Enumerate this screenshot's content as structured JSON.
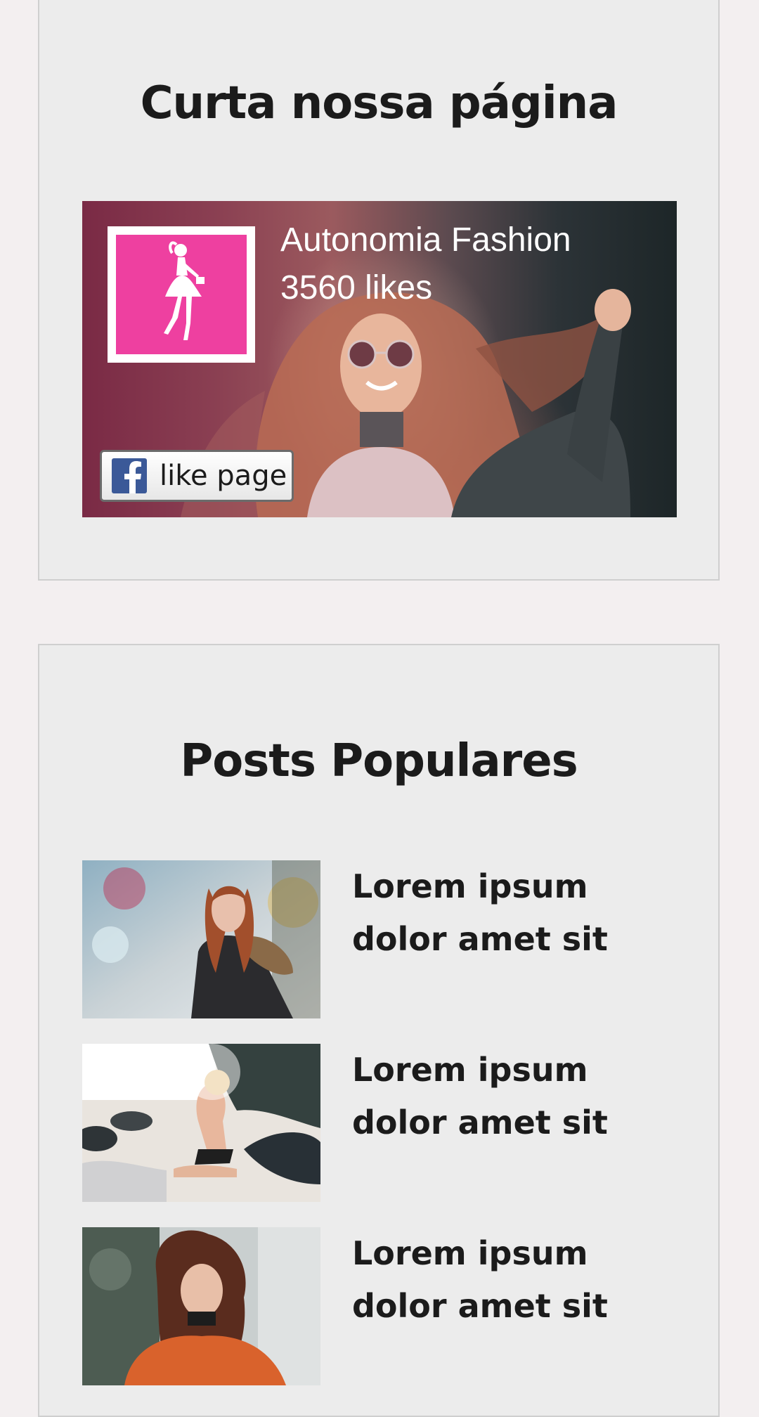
{
  "facebook_widget": {
    "title": "Curta nossa página",
    "page_name": "Autonomia Fashion",
    "likes": "3560 likes",
    "like_button_label": "like page",
    "brand_color": "#ee40a0",
    "facebook_color": "#3b5998"
  },
  "popular_posts": {
    "title": "Posts Populares",
    "posts": [
      {
        "title": "Lorem ipsum dolor amet sit",
        "thumbnail": "woman-snow-fur-jacket"
      },
      {
        "title": "Lorem ipsum dolor amet sit",
        "thumbnail": "woman-sitting-beach-rocks"
      },
      {
        "title": "Lorem ipsum dolor amet sit",
        "thumbnail": "woman-curly-hair-orange-hoodie"
      }
    ]
  }
}
